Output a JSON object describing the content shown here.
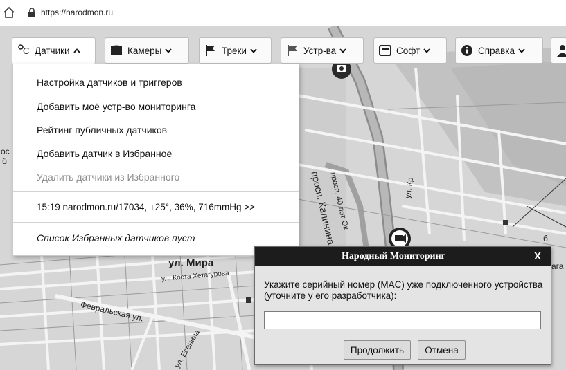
{
  "browser": {
    "url": "https://narodmon.ru"
  },
  "nav": {
    "items": [
      {
        "label": "Датчики",
        "icon": "sensor-icon"
      },
      {
        "label": "Камеры",
        "icon": "camera-icon"
      },
      {
        "label": "Треки",
        "icon": "flag-icon"
      },
      {
        "label": "Устр-ва",
        "icon": "device-icon"
      },
      {
        "label": "Софт",
        "icon": "software-icon"
      },
      {
        "label": "Справка",
        "icon": "info-icon"
      }
    ]
  },
  "dropdown": {
    "items": [
      {
        "label": "Настройка датчиков и триггеров",
        "enabled": true
      },
      {
        "label": "Добавить моё устр-во мониторинга",
        "enabled": true
      },
      {
        "label": "Рейтинг публичных датчиков",
        "enabled": true
      },
      {
        "label": "Добавить датчик в Избранное",
        "enabled": true
      },
      {
        "label": "Удалить датчики из Избранного",
        "enabled": false
      }
    ],
    "status_line": "15:19 narodmon.ru/17034, +25°, 36%, 716mmHg >>",
    "favorites_empty": "Список Избранных датчиков пуст"
  },
  "map": {
    "labels": {
      "prosp_kalinina": "просп. Калинина",
      "prosp_40let": "просп. 40 лет Ок",
      "ul_kr": "ул. Кр",
      "ul_mira": "ул. Мира",
      "ul_kosta": "ул. Коста Хетагурова",
      "fevralskaya": "Февральская ул.",
      "esenina": "ул. Есенина",
      "edge_1": "ос",
      "edge_2": "б",
      "edge_3": "ага",
      "edge_4": "б"
    }
  },
  "dialog": {
    "title": "Народный Мониторинг",
    "close": "X",
    "message": "Укажите серийный номер (MAC) уже подключенного устройства (уточните у его разработчика):",
    "input_value": "",
    "ok_label": "Продолжить",
    "cancel_label": "Отмена"
  }
}
